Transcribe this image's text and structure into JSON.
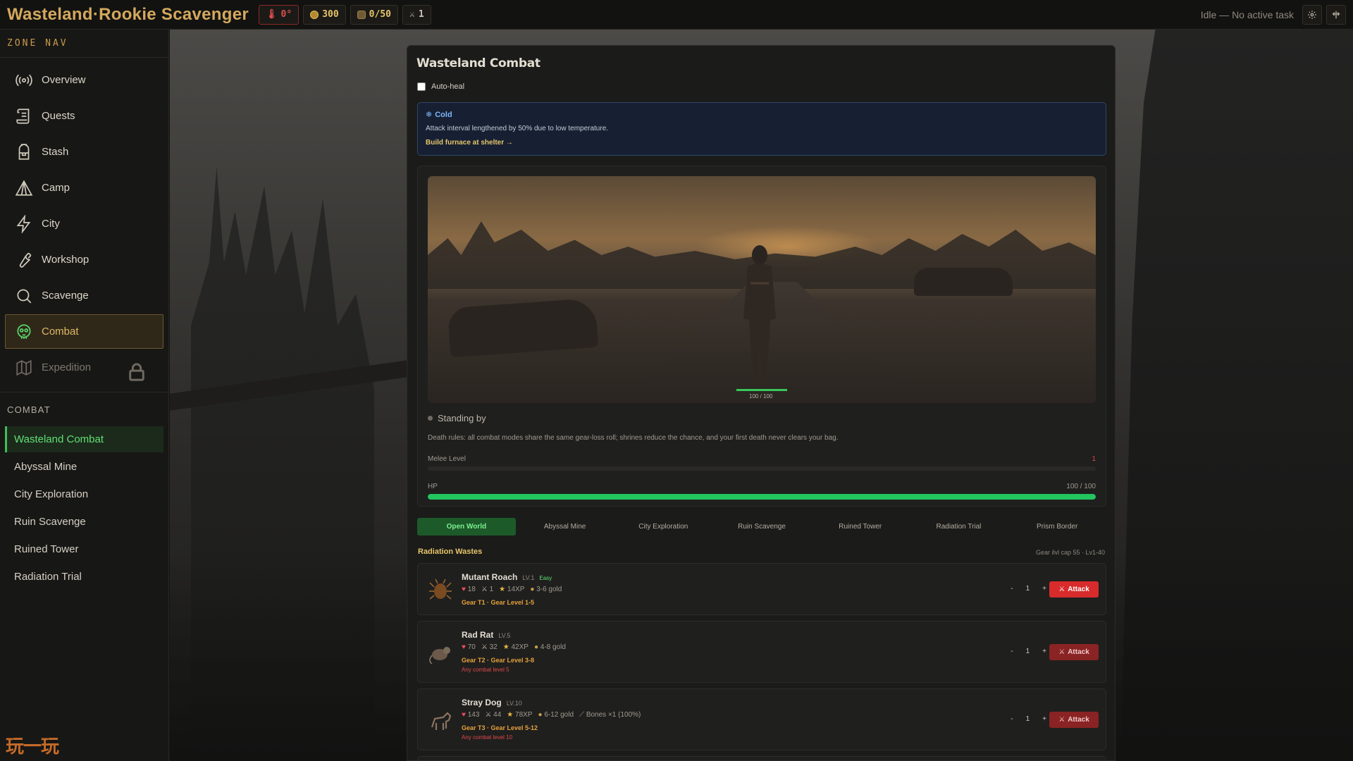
{
  "header": {
    "title": "Wasteland·Rookie Scavenger",
    "temperature": "0°",
    "coins": "300",
    "bag": "0/50",
    "kills": "1",
    "task_status": "Idle — No active task",
    "settings_icon": "gear-icon",
    "layout_icon": "window-split-icon",
    "colors": {
      "accent": "#d4a85c",
      "danger": "#e05050",
      "gold": "#e6c56a"
    }
  },
  "sidebar": {
    "zone_heading": "ZONE NAV",
    "nav": [
      {
        "label": "Overview",
        "icon": "radar-icon"
      },
      {
        "label": "Quests",
        "icon": "scroll-icon"
      },
      {
        "label": "Stash",
        "icon": "backpack-icon"
      },
      {
        "label": "Camp",
        "icon": "tent-icon"
      },
      {
        "label": "City",
        "icon": "lightning-icon"
      },
      {
        "label": "Workshop",
        "icon": "wrench-icon"
      },
      {
        "label": "Scavenge",
        "icon": "search-icon"
      },
      {
        "label": "Combat",
        "icon": "skull-icon",
        "active": true
      },
      {
        "label": "Expedition",
        "icon": "map-icon",
        "locked": true
      }
    ],
    "combat_heading": "COMBAT",
    "combat_items": [
      {
        "label": "Wasteland Combat",
        "active": true
      },
      {
        "label": "Abyssal Mine"
      },
      {
        "label": "City Exploration"
      },
      {
        "label": "Ruin Scavenge"
      },
      {
        "label": "Ruined Tower"
      },
      {
        "label": "Radiation Trial"
      }
    ],
    "logo": "玩一玩"
  },
  "panel": {
    "title": "Wasteland Combat",
    "autoheal_label": "Auto-heal",
    "autoheal_checked": false,
    "alert": {
      "icon": "snowflake-icon",
      "title": "Cold",
      "text": "Attack interval lengthened by 50% due to low temperature.",
      "link": "Build furnace at shelter →"
    },
    "arena": {
      "player_hp_text": "100 / 100",
      "player_hp_fraction": 1.0
    },
    "status": "Standing by",
    "death_rules": "Death rules: all combat modes share the same gear-loss roll; shrines reduce the chance, and your first death never clears your bag.",
    "melee": {
      "label": "Melee Level",
      "value": "1",
      "progress": 0.0
    },
    "hp": {
      "label": "HP",
      "value": "100 / 100",
      "progress": 1.0
    },
    "tabs": [
      {
        "label": "Open World",
        "active": true
      },
      {
        "label": "Abyssal Mine"
      },
      {
        "label": "City Exploration"
      },
      {
        "label": "Ruin Scavenge"
      },
      {
        "label": "Ruined Tower"
      },
      {
        "label": "Radiation Trial"
      },
      {
        "label": "Prism Border"
      }
    ],
    "region": {
      "title": "Radiation Wastes",
      "meta": "Gear ilvl cap 55 · Lv1-40"
    },
    "monsters": [
      {
        "name": "Mutant Roach",
        "level": "LV.1",
        "difficulty": "Easy",
        "hp": "18",
        "atk": "1",
        "xp": "14XP",
        "gold": "3-6 gold",
        "extra": "",
        "gear": "Gear T1 · Gear Level 1-5",
        "requirement": "",
        "qty_minus": "-",
        "qty": "1",
        "qty_plus": "+",
        "attack_label": "Attack",
        "icon": "roach-icon"
      },
      {
        "name": "Rad Rat",
        "level": "LV.5",
        "difficulty": "",
        "hp": "70",
        "atk": "32",
        "xp": "42XP",
        "gold": "4-8 gold",
        "extra": "",
        "gear": "Gear T2 · Gear Level 3-8",
        "requirement": "Any combat level 5",
        "qty_minus": "-",
        "qty": "1",
        "qty_plus": "+",
        "attack_label": "Attack",
        "icon": "rat-icon"
      },
      {
        "name": "Stray Dog",
        "level": "LV.10",
        "difficulty": "",
        "hp": "143",
        "atk": "44",
        "xp": "78XP",
        "gold": "6-12 gold",
        "extra": "Bones ×1 (100%)",
        "gear": "Gear T3 · Gear Level 5-12",
        "requirement": "Any combat level 10",
        "qty_minus": "-",
        "qty": "1",
        "qty_plus": "+",
        "attack_label": "Attack",
        "icon": "dog-icon"
      }
    ]
  }
}
